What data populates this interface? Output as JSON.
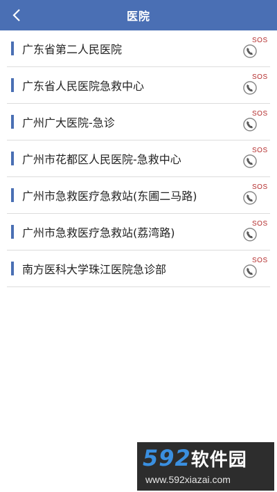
{
  "header": {
    "title": "医院",
    "back_icon": "chevron-left-icon",
    "bg_color": "#4a6fb4"
  },
  "hospitals": [
    {
      "name": "广东省第二人民医院",
      "action_label": "SOS"
    },
    {
      "name": "广东省人民医院急救中心",
      "action_label": "SOS"
    },
    {
      "name": "广州广大医院-急诊",
      "action_label": "SOS"
    },
    {
      "name": "广州市花都区人民医院-急救中心",
      "action_label": "SOS"
    },
    {
      "name": "广州市急救医疗急救站(东圃二马路)",
      "action_label": "SOS"
    },
    {
      "name": "广州市急救医疗急救站(荔湾路)",
      "action_label": "SOS"
    },
    {
      "name": "南方医科大学珠江医院急诊部",
      "action_label": "SOS"
    }
  ],
  "watermark": {
    "logo_number": "592",
    "logo_text": "软件园",
    "url": "www.592xiazai.com"
  }
}
